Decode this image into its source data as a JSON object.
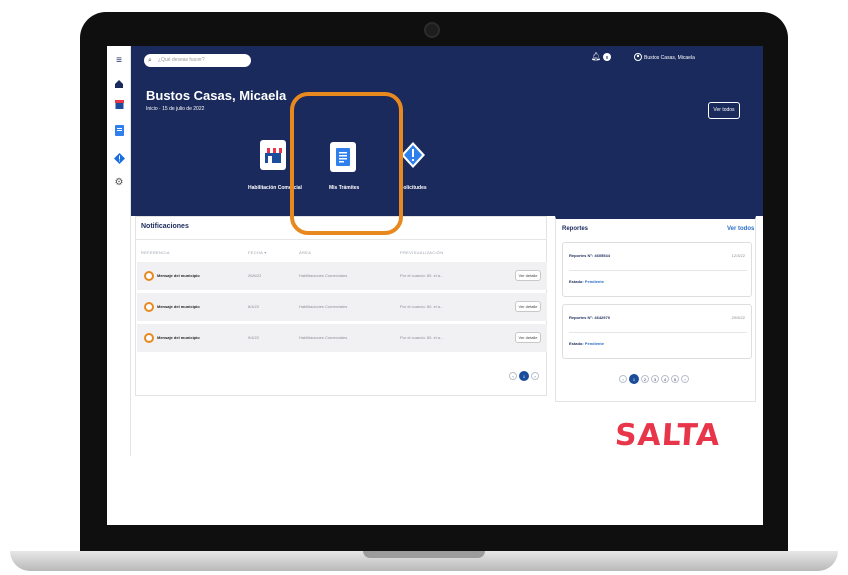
{
  "topbar": {
    "search_placeholder": "¿Qué deseas hacer?",
    "user_label": "Bustos Casas, Micaela"
  },
  "hero": {
    "user_name": "Bustos Casas, Micaela",
    "subtitle": "Inicio · 15 de julio de 2022",
    "ver_todos": "Ver todos",
    "tiles": [
      {
        "label": "Habilitación Comercial",
        "icon": "store-icon"
      },
      {
        "label": "Mis Trámites",
        "icon": "document-icon"
      },
      {
        "label": "Solicitudes",
        "icon": "alert-icon"
      }
    ]
  },
  "notifications": {
    "title": "Notificaciones",
    "headers": {
      "ref": "REFERENCIA",
      "fecha": "FECHA ▾",
      "area": "ÁREA",
      "preview": "PREVISUALIZACIÓN"
    },
    "rows": [
      {
        "ref": "Mensaje del municipio",
        "fecha": "26/6/22",
        "area": "Habilitaciones Comerciales",
        "preview": "Por el cuando: 80. el a...",
        "action": "Ver detalle"
      },
      {
        "ref": "Mensaje del municipio",
        "fecha": "8/4/22",
        "area": "Habilitaciones Comerciales",
        "preview": "Por el cuando: 80. el a...",
        "action": "Ver detalle"
      },
      {
        "ref": "Mensaje del municipio",
        "fecha": "9/4/22",
        "area": "Habilitaciones Comerciales",
        "preview": "Por el cuando: 80. el a...",
        "action": "Ver detalle"
      }
    ],
    "pager": {
      "prev": "‹",
      "current": "1",
      "next": "›"
    }
  },
  "reports": {
    "title": "Reportes",
    "ver_todos": "Ver todos",
    "cards": [
      {
        "title": "Reportes N°: 4605544",
        "date": "12/3/22",
        "status_label": "Estado:",
        "status": "Pendiente"
      },
      {
        "title": "Reportes N°: 4642970",
        "date": "29/5/22",
        "status_label": "Estado:",
        "status": "Pendiente"
      }
    ],
    "pager": [
      "‹",
      "1",
      "2",
      "3",
      "4",
      "5",
      "›"
    ]
  },
  "brand": {
    "logo_text": "SALTA",
    "logo_color": "#e8354a"
  },
  "colors": {
    "primary": "#1b2a5c",
    "accent": "#e8891f"
  }
}
